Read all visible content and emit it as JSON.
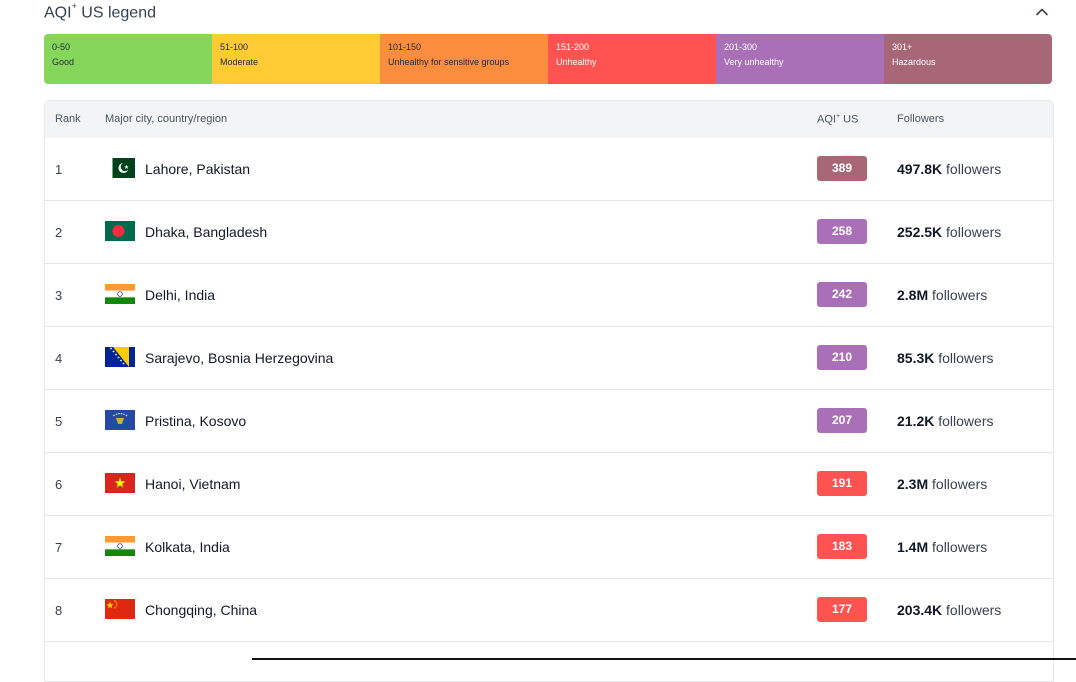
{
  "legend": {
    "title_main": "AQI",
    "title_sup": "+",
    "title_rest": " US legend",
    "segments": [
      {
        "range": "0-50",
        "label": "Good",
        "color": "#87d65c",
        "text_color": "#1f2937"
      },
      {
        "range": "51-100",
        "label": "Moderate",
        "color": "#fecb35",
        "text_color": "#1f2937"
      },
      {
        "range": "101-150",
        "label": "Unhealthy for sensitive groups",
        "color": "#fb8d3f",
        "text_color": "#1f2937"
      },
      {
        "range": "151-200",
        "label": "Unhealthy",
        "color": "#fe5350",
        "text_color": "#ffffff"
      },
      {
        "range": "201-300",
        "label": "Very unhealthy",
        "color": "#a970b8",
        "text_color": "#ffffff"
      },
      {
        "range": "301+",
        "label": "Hazardous",
        "color": "#a86776",
        "text_color": "#ffffff"
      }
    ]
  },
  "table": {
    "headers": {
      "rank": "Rank",
      "city": "Major city, country/region",
      "aqi_main": "AQI",
      "aqi_sup": "+",
      "aqi_rest": " US",
      "followers": "Followers"
    },
    "rows": [
      {
        "rank": "1",
        "city": "Lahore, Pakistan",
        "aqi": "389",
        "aqi_color": "#a86776",
        "followers_count": "497.8K",
        "followers_word": " followers",
        "flag": "pakistan-flag-icon"
      },
      {
        "rank": "2",
        "city": "Dhaka, Bangladesh",
        "aqi": "258",
        "aqi_color": "#a970b8",
        "followers_count": "252.5K",
        "followers_word": " followers",
        "flag": "bangladesh-flag-icon"
      },
      {
        "rank": "3",
        "city": "Delhi, India",
        "aqi": "242",
        "aqi_color": "#a970b8",
        "followers_count": "2.8M",
        "followers_word": " followers",
        "flag": "india-flag-icon"
      },
      {
        "rank": "4",
        "city": "Sarajevo, Bosnia Herzegovina",
        "aqi": "210",
        "aqi_color": "#a970b8",
        "followers_count": "85.3K",
        "followers_word": " followers",
        "flag": "bosnia-flag-icon"
      },
      {
        "rank": "5",
        "city": "Pristina, Kosovo",
        "aqi": "207",
        "aqi_color": "#a970b8",
        "followers_count": "21.2K",
        "followers_word": " followers",
        "flag": "kosovo-flag-icon"
      },
      {
        "rank": "6",
        "city": "Hanoi, Vietnam",
        "aqi": "191",
        "aqi_color": "#fe5350",
        "followers_count": "2.3M",
        "followers_word": " followers",
        "flag": "vietnam-flag-icon"
      },
      {
        "rank": "7",
        "city": "Kolkata, India",
        "aqi": "183",
        "aqi_color": "#fe5350",
        "followers_count": "1.4M",
        "followers_word": " followers",
        "flag": "india-flag-icon"
      },
      {
        "rank": "8",
        "city": "Chongqing, China",
        "aqi": "177",
        "aqi_color": "#fe5350",
        "followers_count": "203.4K",
        "followers_word": " followers",
        "flag": "china-flag-icon"
      }
    ]
  },
  "icons": {
    "collapse": "chevron-up-icon"
  }
}
